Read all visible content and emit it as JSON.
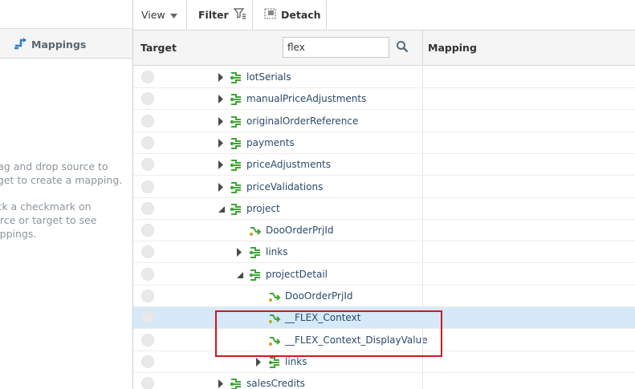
{
  "left_panel": {
    "title": "Mappings",
    "hint_line1": "rag and drop source to",
    "hint_line2": "rget to create a mapping.",
    "hint_line3": "ick a checkmark on",
    "hint_line4": "urce or target to see",
    "hint_line5": "appings."
  },
  "toolbar": {
    "view_label": "View",
    "filter_label": "Filter",
    "detach_label": "Detach"
  },
  "columns": {
    "target": "Target",
    "mapping": "Mapping"
  },
  "search": {
    "value": "flex"
  },
  "colors": {
    "node_green": "#3fa535",
    "highlight_red": "#d9141e",
    "selected_row": "#d6e9f8"
  },
  "tree": [
    {
      "label": "lotSerials",
      "level": 1,
      "expander": "collapsed",
      "icon": "entity-icon"
    },
    {
      "label": "manualPriceAdjustments",
      "level": 1,
      "expander": "collapsed",
      "icon": "entity-icon"
    },
    {
      "label": "originalOrderReference",
      "level": 1,
      "expander": "collapsed",
      "icon": "entity-icon"
    },
    {
      "label": "payments",
      "level": 1,
      "expander": "collapsed",
      "icon": "entity-icon"
    },
    {
      "label": "priceAdjustments",
      "level": 1,
      "expander": "collapsed",
      "icon": "entity-icon"
    },
    {
      "label": "priceValidations",
      "level": 1,
      "expander": "collapsed",
      "icon": "entity-icon"
    },
    {
      "label": "project",
      "level": 1,
      "expander": "expanded",
      "icon": "entity-icon"
    },
    {
      "label": "DooOrderPrjId",
      "level": 2,
      "expander": "none",
      "icon": "attribute-icon"
    },
    {
      "label": "links",
      "level": 2,
      "expander": "collapsed",
      "icon": "entity-icon"
    },
    {
      "label": "projectDetail",
      "level": 2,
      "expander": "expanded",
      "icon": "entity-icon"
    },
    {
      "label": "DooOrderPrjId",
      "level": 3,
      "expander": "none",
      "icon": "attribute-icon"
    },
    {
      "label": "__FLEX_Context",
      "level": 3,
      "expander": "none",
      "icon": "attribute-icon",
      "selected": true
    },
    {
      "label": "__FLEX_Context_DisplayValue",
      "level": 3,
      "expander": "none",
      "icon": "attribute-icon"
    },
    {
      "label": "links",
      "level": 3,
      "expander": "collapsed",
      "icon": "entity-icon"
    },
    {
      "label": "salesCredits",
      "level": 1,
      "expander": "collapsed",
      "icon": "entity-icon"
    }
  ]
}
